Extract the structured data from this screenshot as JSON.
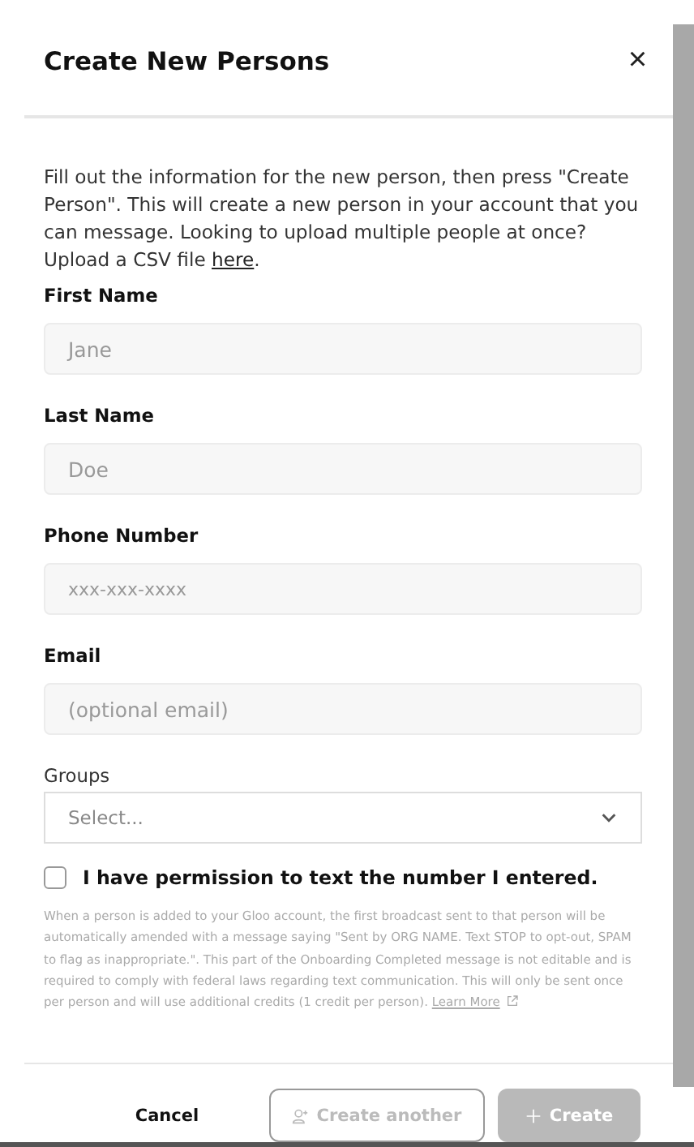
{
  "dialog": {
    "title": "Create New Persons",
    "close": "×"
  },
  "intro": {
    "text": "Fill out the information for the new person, then press \"Create Person\". This will create a new person in your account that you can message. Looking to upload multiple people at once? Upload a CSV file ",
    "link": "here",
    "end": "."
  },
  "fields": [
    {
      "kind": "text",
      "label": "First Name",
      "placeholder": "Jane"
    },
    {
      "kind": "text",
      "label": "Last Name",
      "placeholder": "Doe"
    },
    {
      "kind": "phone",
      "label": "Phone Number",
      "placeholder": "xxx-xxx-xxxx"
    },
    {
      "kind": "text",
      "label": "Email",
      "placeholder": "(optional email)"
    },
    {
      "kind": "select",
      "label": "Groups",
      "placeholder": "Select..."
    }
  ],
  "permission": {
    "label": "I have permission to text the number I entered.",
    "checked": false
  },
  "disclaimer": {
    "text": "When a person is added to your Gloo account, the first broadcast sent to that person will be automatically amended with a message saying \"Sent by ORG NAME. Text STOP to opt-out, SPAM to flag as inappropriate.\". This part of the Onboarding Completed message is not editable and is required to comply with federal laws regarding text communication. This will only be sent once per person and will use additional credits (1 credit per person).",
    "link": "Learn More"
  },
  "buttons": [
    {
      "kind": "plain",
      "label": "Cancel"
    },
    {
      "kind": "outline",
      "label": "Create another",
      "disabled": true
    },
    {
      "kind": "primary",
      "label": "Create",
      "disabled": true
    }
  ]
}
